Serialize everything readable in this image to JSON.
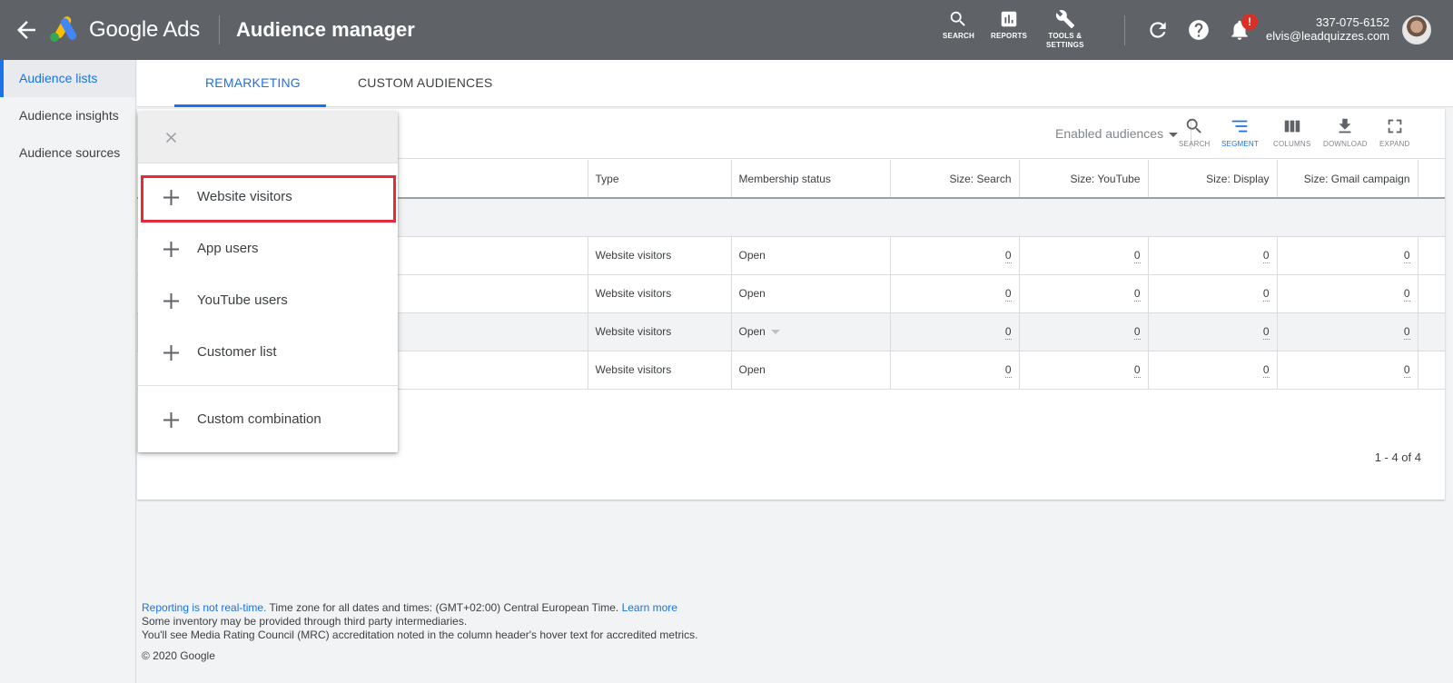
{
  "header": {
    "brand": "Google Ads",
    "page_title": "Audience manager",
    "tools": [
      {
        "label": "SEARCH",
        "icon": "search-icon"
      },
      {
        "label": "REPORTS",
        "icon": "reports-icon"
      },
      {
        "label_line1": "TOOLS &",
        "label_line2": "SETTINGS",
        "icon": "wrench-icon"
      }
    ],
    "notification_badge": "!",
    "account_phone": "337-075-6152",
    "account_email": "elvis@leadquizzes.com"
  },
  "sidebar": {
    "items": [
      {
        "label": "Audience lists",
        "active": true
      },
      {
        "label": "Audience insights",
        "active": false
      },
      {
        "label": "Audience sources",
        "active": false
      }
    ]
  },
  "tabs": [
    {
      "label": "REMARKETING",
      "active": true
    },
    {
      "label": "CUSTOM AUDIENCES",
      "active": false
    }
  ],
  "toolbar": {
    "filter_label": "Enabled audiences",
    "tools": [
      "SEARCH",
      "SEGMENT",
      "COLUMNS",
      "DOWNLOAD",
      "EXPAND"
    ],
    "active_tool": "SEGMENT"
  },
  "table": {
    "columns": [
      "Type",
      "Membership status",
      "Size: Search",
      "Size: YouTube",
      "Size: Display",
      "Size: Gmail campaign"
    ],
    "rows": [
      {
        "type": "Website visitors",
        "status": "Open",
        "search": "0",
        "youtube": "0",
        "display": "0",
        "gmail": "0"
      },
      {
        "type": "Website visitors",
        "status": "Open",
        "search": "0",
        "youtube": "0",
        "display": "0",
        "gmail": "0"
      },
      {
        "type": "Website visitors",
        "status": "Open",
        "search": "0",
        "youtube": "0",
        "display": "0",
        "gmail": "0"
      },
      {
        "type": "Website visitors",
        "status": "Open",
        "search": "0",
        "youtube": "0",
        "display": "0",
        "gmail": "0"
      }
    ],
    "pagination": "1 - 4 of 4"
  },
  "popup_menu": {
    "items": [
      {
        "label": "Website visitors",
        "highlighted": true
      },
      {
        "label": "App users"
      },
      {
        "label": "YouTube users"
      },
      {
        "label": "Customer list"
      },
      {
        "label": "Custom combination"
      }
    ]
  },
  "footer": {
    "reporting_link": "Reporting is not real-time.",
    "timezone_text": " Time zone for all dates and times: (GMT+02:00) Central European Time. ",
    "learn_more": "Learn more",
    "line2": "Some inventory may be provided through third party intermediaries.",
    "line3": "You'll see Media Rating Council (MRC) accreditation noted in the column header's hover text for accredited metrics.",
    "copyright": "© 2020 Google"
  },
  "colors": {
    "header_bg": "#5f6368",
    "accent": "#1a73e8",
    "highlight_box": "#e52b3a",
    "badge": "#d93025"
  }
}
